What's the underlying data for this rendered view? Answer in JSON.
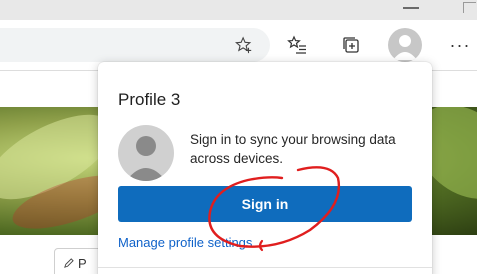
{
  "toolbar": {
    "favorite_star_icon": "star-plus-icon",
    "favorites_icon": "favorites-list-icon",
    "collections_icon": "collections-icon",
    "profile_icon": "profile-avatar-icon",
    "more_label": "···"
  },
  "page": {
    "chip_label": "P"
  },
  "profile_flyout": {
    "title": "Profile 3",
    "message": "Sign in to sync your browsing data across devices.",
    "sign_in_label": "Sign in",
    "manage_link": "Manage profile settings"
  },
  "colors": {
    "accent_button": "#0f6cbd",
    "link": "#0f62c9",
    "annotation": "#e01e1e"
  }
}
